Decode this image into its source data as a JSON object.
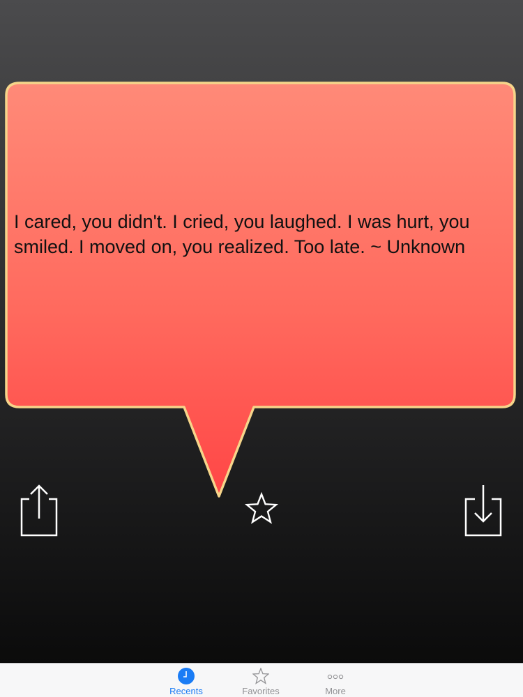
{
  "quote": {
    "text": "I cared, you didn't. I cried, you laughed. I was hurt, you smiled. I moved on, you realized. Too late. ~ Unknown"
  },
  "actions": {
    "share_icon": "share-icon",
    "favorite_icon": "star-outline-icon",
    "save_icon": "download-icon"
  },
  "tabbar": {
    "tabs": [
      {
        "label": "Recents",
        "icon": "clock-icon",
        "selected": true
      },
      {
        "label": "Favorites",
        "icon": "star-icon",
        "selected": false
      },
      {
        "label": "More",
        "icon": "more-dots-icon",
        "selected": false
      }
    ]
  },
  "colors": {
    "bubble_top": "#ff8c78",
    "bubble_bottom": "#ff4a48",
    "bubble_border": "#f6d58a",
    "tab_active": "#1a7cf5",
    "tab_inactive": "#929295"
  }
}
